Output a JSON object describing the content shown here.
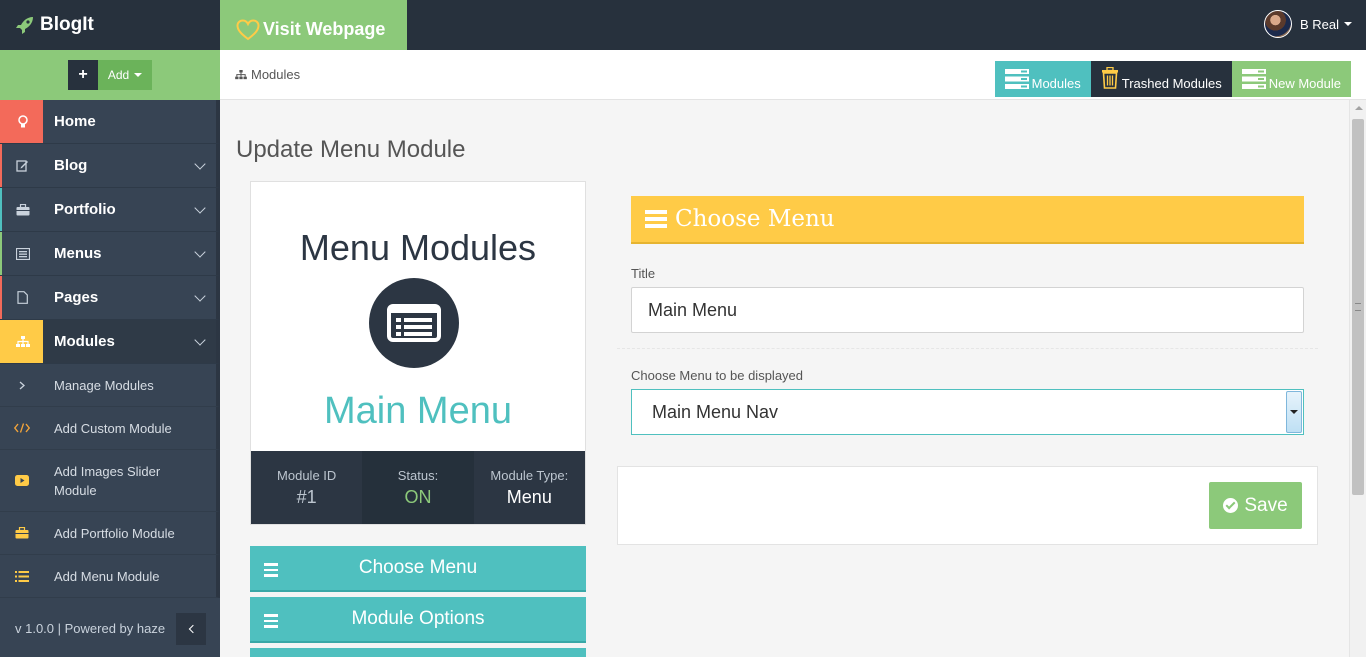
{
  "app": {
    "brand": "BlogIt",
    "visit_label": "Visit Webpage",
    "user_name": "B Real"
  },
  "sidebar": {
    "add_label": "Add",
    "nav": [
      {
        "label": "Home",
        "icon": "lightbulb-icon"
      },
      {
        "label": "Blog",
        "icon": "edit-icon"
      },
      {
        "label": "Portfolio",
        "icon": "briefcase-icon"
      },
      {
        "label": "Menus",
        "icon": "list-alt-icon"
      },
      {
        "label": "Pages",
        "icon": "file-icon"
      },
      {
        "label": "Modules",
        "icon": "sitemap-icon"
      }
    ],
    "sub": [
      {
        "label": "Manage Modules",
        "icon": "chevron-right-icon"
      },
      {
        "label": "Add Custom Module",
        "icon": "code-icon"
      },
      {
        "label": "Add Images Slider Module",
        "icon": "youtube-play-icon"
      },
      {
        "label": "Add Portfolio Module",
        "icon": "briefcase-icon"
      },
      {
        "label": "Add Menu Module",
        "icon": "list-icon"
      }
    ],
    "footer": "v 1.0.0 | Powered by haze"
  },
  "header": {
    "breadcrumb": "Modules",
    "actions": {
      "modules": "Modules",
      "trashed": "Trashed Modules",
      "new": "New Module"
    }
  },
  "main": {
    "page_title": "Update Menu Module",
    "card": {
      "title": "Menu Modules",
      "name": "Main Menu",
      "id_label": "Module ID",
      "id_value": "#1",
      "status_label": "Status:",
      "status_value": "ON",
      "type_label": "Module Type:",
      "type_value": "Menu"
    },
    "tabs": [
      "Choose Menu",
      "Module Options"
    ],
    "form": {
      "header": "Choose Menu",
      "title_label": "Title",
      "title_value": "Main Menu",
      "select_label": "Choose Menu to be displayed",
      "select_value": "Main Menu Nav",
      "save_label": "Save"
    }
  },
  "colors": {
    "dark": "#27313d",
    "sidebar": "#374454",
    "green": "#8cc97a",
    "teal": "#4fc0bf",
    "yellow": "#ffcb47",
    "red": "#f36a5a"
  }
}
